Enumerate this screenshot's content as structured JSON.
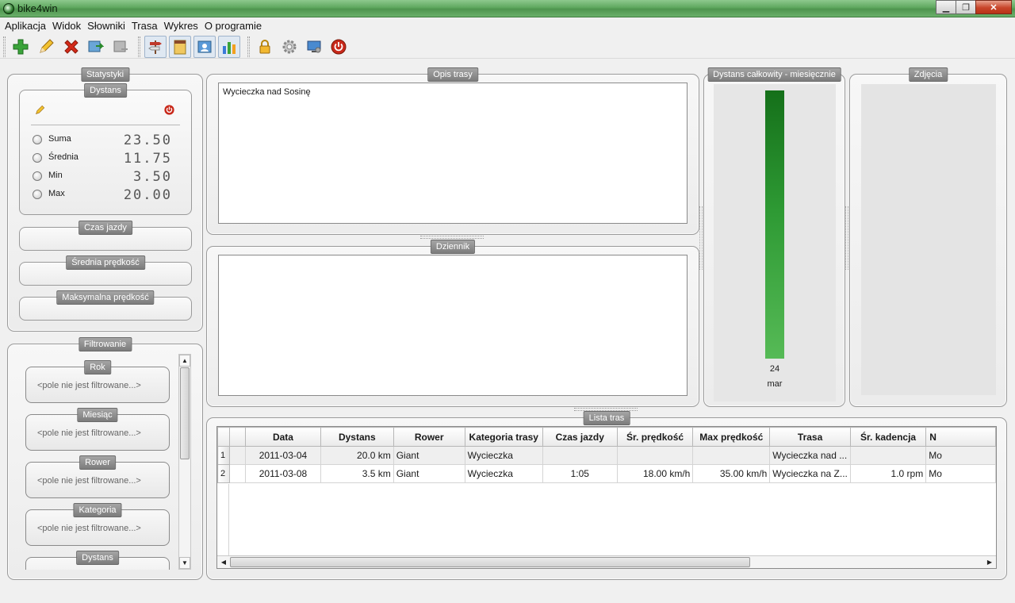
{
  "window": {
    "title": "bike4win",
    "minimize": "▁",
    "maximize": "❐",
    "close": "✕"
  },
  "menu": [
    "Aplikacja",
    "Widok",
    "Słowniki",
    "Trasa",
    "Wykres",
    "O programie"
  ],
  "toolbar": {
    "buttons": [
      "add-route",
      "edit-route",
      "delete-route",
      "import",
      "export",
      "route-view",
      "notes-view",
      "photos-view",
      "chart-view",
      "lock",
      "settings",
      "screen",
      "exit"
    ],
    "active": [
      "route-view",
      "photos-view",
      "chart-view"
    ]
  },
  "stats": {
    "title": "Statystyki",
    "distance": {
      "title": "Dystans",
      "rows": [
        {
          "label": "Suma",
          "value": "23.50"
        },
        {
          "label": "Średnia",
          "value": "11.75"
        },
        {
          "label": "Min",
          "value": "3.50"
        },
        {
          "label": "Max",
          "value": "20.00"
        }
      ]
    },
    "ride_time": "Czas jazdy",
    "avg_speed": "Średnia prędkość",
    "max_speed": "Maksymalna prędkość"
  },
  "filter": {
    "title": "Filtrowanie",
    "fields": [
      {
        "label": "Rok",
        "value": "<pole nie jest filtrowane...>"
      },
      {
        "label": "Miesiąc",
        "value": "<pole nie jest filtrowane...>"
      },
      {
        "label": "Rower",
        "value": "<pole nie jest filtrowane...>"
      },
      {
        "label": "Kategoria",
        "value": "<pole nie jest filtrowane...>"
      },
      {
        "label": "Dystans",
        "value": ""
      }
    ],
    "scroll_up": "▲",
    "scroll_down": "▼"
  },
  "description": {
    "title": "Opis trasy",
    "text": "Wycieczka nad Sosinę"
  },
  "journal": {
    "title": "Dziennik",
    "text": ""
  },
  "monthly_chart": {
    "title": "Dystans całkowity - miesięcznie"
  },
  "photos": {
    "title": "Zdjęcia"
  },
  "chart_data": {
    "type": "bar",
    "categories": [
      "mar"
    ],
    "values": [
      24
    ],
    "value_labels": [
      "24"
    ],
    "title": "Dystans całkowity - miesięcznie",
    "color": "#2e9a34",
    "ylim": [
      0,
      24
    ]
  },
  "routes": {
    "title": "Lista tras",
    "columns": [
      "",
      "",
      "Data",
      "Dystans",
      "Rower",
      "Kategoria trasy",
      "Czas jazdy",
      "Śr. prędkość",
      "Max prędkość",
      "Trasa",
      "Śr. kadencja",
      "N"
    ],
    "rows": [
      {
        "n": "1",
        "data": "2011-03-04",
        "dystans": "20.0 km",
        "rower": "Giant",
        "kategoria": "Wycieczka",
        "czas": "",
        "sr": "",
        "max": "",
        "trasa": "Wycieczka nad ...",
        "kadencja": "",
        "extra": "Mo"
      },
      {
        "n": "2",
        "data": "2011-03-08",
        "dystans": "3.5 km",
        "rower": "Giant",
        "kategoria": "Wycieczka",
        "czas": "1:05",
        "sr": "18.00 km/h",
        "max": "35.00 km/h",
        "trasa": "Wycieczka na Z...",
        "kadencja": "1.0 rpm",
        "extra": "Mo"
      }
    ],
    "scroll_left": "◀",
    "scroll_right": "▶"
  }
}
